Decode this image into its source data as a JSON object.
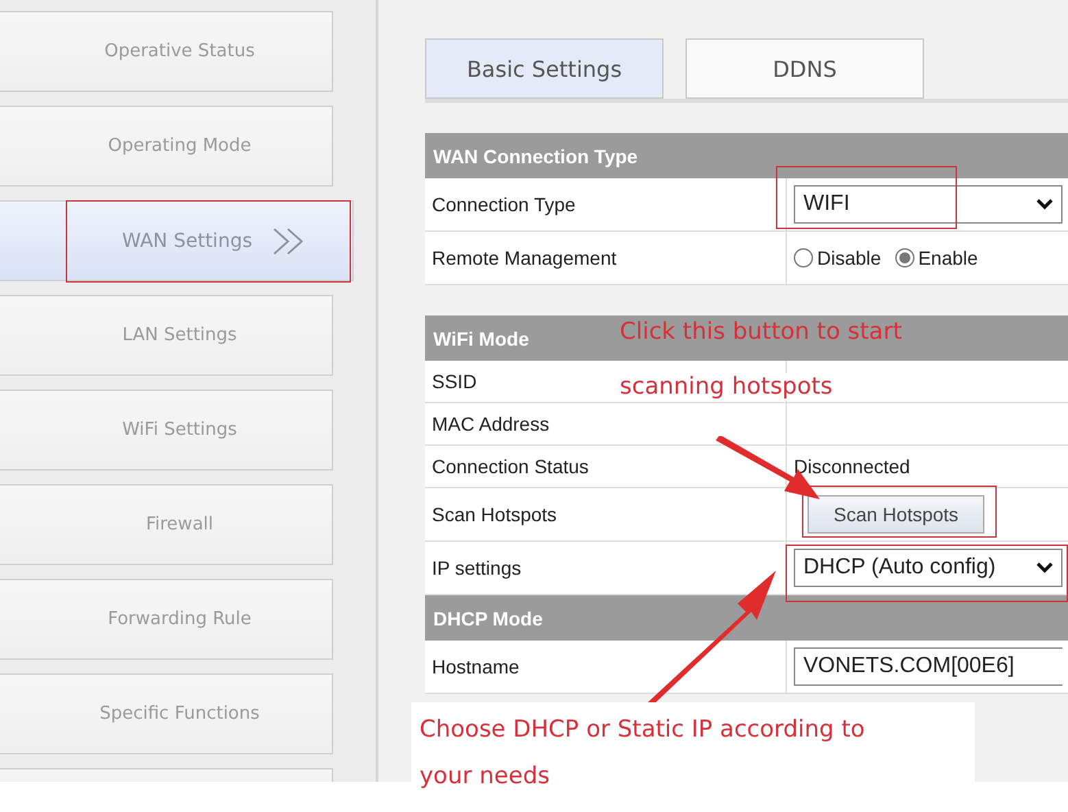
{
  "sidebar": {
    "items": [
      {
        "label": "Operative Status",
        "selected": false
      },
      {
        "label": "Operating Mode",
        "selected": false
      },
      {
        "label": "WAN Settings",
        "selected": true
      },
      {
        "label": "LAN Settings",
        "selected": false
      },
      {
        "label": "WiFi Settings",
        "selected": false
      },
      {
        "label": "Firewall",
        "selected": false
      },
      {
        "label": "Forwarding Rule",
        "selected": false
      },
      {
        "label": "Specific Functions",
        "selected": false
      }
    ]
  },
  "tabs": [
    {
      "label": "Basic Settings",
      "selected": true
    },
    {
      "label": "DDNS",
      "selected": false
    }
  ],
  "sections": [
    {
      "title": "WAN Connection Type",
      "rows": [
        {
          "kind": "select",
          "label": "Connection Type",
          "value": "WIFI"
        },
        {
          "kind": "radio",
          "label": "Remote Management",
          "options": [
            {
              "label": "Disable",
              "selected": false
            },
            {
              "label": "Enable",
              "selected": true
            }
          ]
        }
      ]
    },
    {
      "title": "WiFi Mode",
      "rows": [
        {
          "kind": "empty",
          "label": "SSID"
        },
        {
          "kind": "empty",
          "label": "MAC Address"
        },
        {
          "kind": "text",
          "label": "Connection Status",
          "value": "Disconnected"
        },
        {
          "kind": "button",
          "label": "Scan Hotspots",
          "value": "Scan Hotspots"
        },
        {
          "kind": "select",
          "label": "IP settings",
          "value": "DHCP (Auto config)"
        }
      ]
    },
    {
      "title": "DHCP Mode",
      "rows": [
        {
          "kind": "input",
          "label": "Hostname",
          "value": "VONETS.COM[00E6]"
        }
      ]
    }
  ],
  "annotations": [
    "Click this button to start",
    "scanning hotspots",
    "Choose DHCP or Static IP according to",
    "your needs"
  ]
}
